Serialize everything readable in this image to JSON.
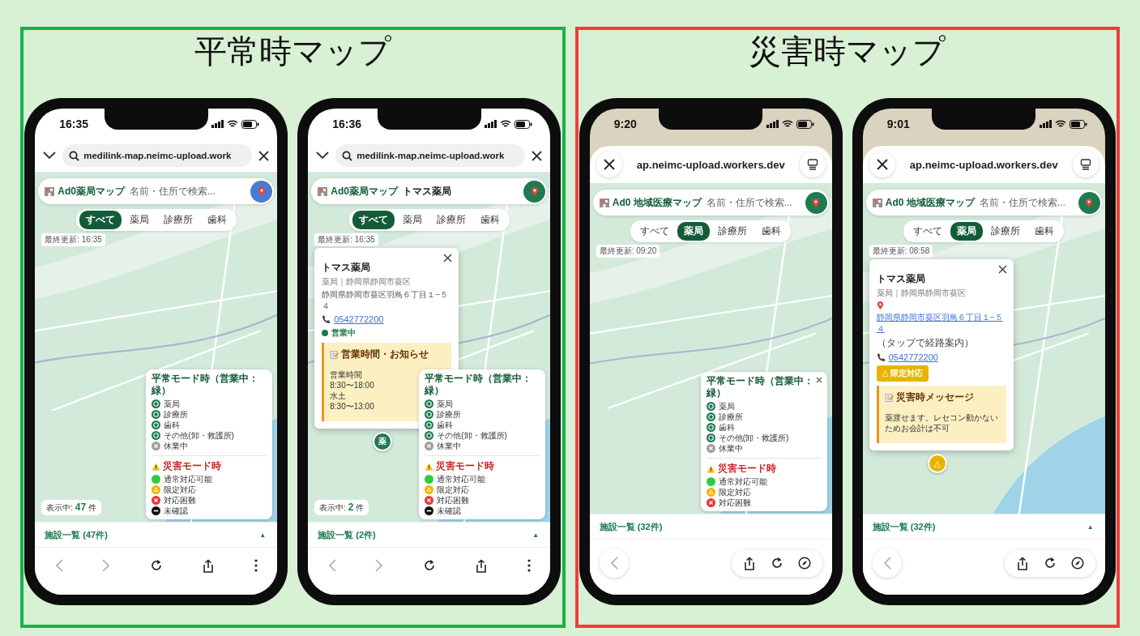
{
  "panels": [
    {
      "title": "平常時マップ",
      "color": "#17b24a",
      "phones": [
        {
          "time": "16:35",
          "browser": {
            "kind": "chrome",
            "url": "medilink-map.neimc-upload.work"
          },
          "app": {
            "title": "Ad0薬局マップ",
            "search_placeholder": "名前・住所で検索...",
            "locate_button": {
              "color": "#4a7bd0"
            }
          },
          "filters": [
            {
              "label": "すべて",
              "selected": true
            },
            {
              "label": "薬局",
              "selected": false
            },
            {
              "label": "診療所",
              "selected": false
            },
            {
              "label": "歯科",
              "selected": false
            }
          ],
          "last_updated": "最終更新: 16:35",
          "visible_count": {
            "label": "表示中:",
            "count": "47",
            "unit": "件"
          },
          "legend": {
            "closable": false,
            "sections": [
              {
                "kind": "normal",
                "title": "平常モード時（営業中：緑）",
                "items": [
                  {
                    "kind": "facility",
                    "label": "薬局",
                    "color": "#1e7b4f"
                  },
                  {
                    "kind": "facility",
                    "label": "診療所",
                    "color": "#1e7b4f"
                  },
                  {
                    "kind": "facility",
                    "label": "歯科",
                    "color": "#1e7b4f"
                  },
                  {
                    "kind": "facility",
                    "label": "その他(卸・救護所)",
                    "color": "#1e7b4f"
                  },
                  {
                    "kind": "closed",
                    "label": "休業中",
                    "color": "#9e9e9e"
                  }
                ]
              },
              {
                "kind": "disaster",
                "title": "災害モード時",
                "items": [
                  {
                    "kind": "available",
                    "label": "通常対応可能",
                    "color": "#2ecc40"
                  },
                  {
                    "kind": "limited",
                    "label": "限定対応",
                    "color": "#f0b400"
                  },
                  {
                    "kind": "difficult",
                    "label": "対応困難",
                    "color": "#e53935"
                  },
                  {
                    "kind": "unconfirmed",
                    "label": "未確認",
                    "color": "#111111"
                  }
                ]
              }
            ]
          },
          "list_bar": {
            "label": "施設一覧 (47件)",
            "toggle": "▲"
          }
        },
        {
          "time": "16:36",
          "browser": {
            "kind": "chrome",
            "url": "medilink-map.neimc-upload.work"
          },
          "app": {
            "title": "Ad0薬局マップ",
            "search_value": "トマス薬局",
            "locate_button": {
              "color": "#1e7b4f"
            }
          },
          "filters": [
            {
              "label": "すべて",
              "selected": true
            },
            {
              "label": "薬局",
              "selected": false
            },
            {
              "label": "診療所",
              "selected": false
            },
            {
              "label": "歯科",
              "selected": false
            }
          ],
          "last_updated": "最終更新: 16:35",
          "visible_count": {
            "label": "表示中:",
            "count": "2",
            "unit": "件"
          },
          "popup": {
            "name": "トマス薬局",
            "category": "薬局｜静岡県静岡市葵区",
            "address": {
              "kind": "plain",
              "text": "静岡県静岡市葵区羽鳥６丁目１−５４"
            },
            "phone": "0542772200",
            "status": {
              "kind": "open",
              "label": "営業中"
            },
            "notice": {
              "title": "営業時間・お知らせ",
              "lines": [
                "営業時間",
                "8:30〜18:00",
                "水土",
                "8:30〜13:00"
              ]
            },
            "marker": {
              "glyph": "薬",
              "color": "#1e7b4f"
            }
          },
          "legend": {
            "closable": false,
            "sections": [
              {
                "kind": "normal",
                "title": "平常モード時（営業中：緑）",
                "items": [
                  {
                    "kind": "facility",
                    "label": "薬局",
                    "color": "#1e7b4f"
                  },
                  {
                    "kind": "facility",
                    "label": "診療所",
                    "color": "#1e7b4f"
                  },
                  {
                    "kind": "facility",
                    "label": "歯科",
                    "color": "#1e7b4f"
                  },
                  {
                    "kind": "facility",
                    "label": "その他(卸・救護所)",
                    "color": "#1e7b4f"
                  },
                  {
                    "kind": "closed",
                    "label": "休業中",
                    "color": "#9e9e9e"
                  }
                ]
              },
              {
                "kind": "disaster",
                "title": "災害モード時",
                "items": [
                  {
                    "kind": "available",
                    "label": "通常対応可能",
                    "color": "#2ecc40"
                  },
                  {
                    "kind": "limited",
                    "label": "限定対応",
                    "color": "#f0b400"
                  },
                  {
                    "kind": "difficult",
                    "label": "対応困難",
                    "color": "#e53935"
                  },
                  {
                    "kind": "unconfirmed",
                    "label": "未確認",
                    "color": "#111111"
                  }
                ]
              }
            ]
          },
          "list_bar": {
            "label": "施設一覧 (2件)",
            "toggle": "▲"
          }
        }
      ]
    },
    {
      "title": "災害時マップ",
      "color": "#f03c3c",
      "phones": [
        {
          "time": "9:20",
          "browser": {
            "kind": "safari",
            "url": "ap.neimc-upload.workers.dev"
          },
          "app": {
            "title": "Ad0 地域医療マップ",
            "search_placeholder": "名前・住所で検索...",
            "locate_button": {
              "color": "#1e7b4f"
            }
          },
          "filters": [
            {
              "label": "すべて",
              "selected": false
            },
            {
              "label": "薬局",
              "selected": true
            },
            {
              "label": "診療所",
              "selected": false
            },
            {
              "label": "歯科",
              "selected": false
            }
          ],
          "last_updated": "最終更新: 09:20",
          "legend": {
            "closable": true,
            "sections": [
              {
                "kind": "normal",
                "title": "平常モード時（営業中：緑）",
                "items": [
                  {
                    "kind": "facility",
                    "label": "薬局",
                    "color": "#1e7b4f"
                  },
                  {
                    "kind": "facility",
                    "label": "診療所",
                    "color": "#1e7b4f"
                  },
                  {
                    "kind": "facility",
                    "label": "歯科",
                    "color": "#1e7b4f"
                  },
                  {
                    "kind": "facility",
                    "label": "その他(卸・救護所)",
                    "color": "#1e7b4f"
                  },
                  {
                    "kind": "closed",
                    "label": "休業中",
                    "color": "#9e9e9e"
                  }
                ]
              },
              {
                "kind": "disaster",
                "title": "災害モード時",
                "items": [
                  {
                    "kind": "available",
                    "label": "通常対応可能",
                    "color": "#2ecc40"
                  },
                  {
                    "kind": "limited",
                    "label": "限定対応",
                    "color": "#f0b400"
                  },
                  {
                    "kind": "difficult",
                    "label": "対応困難",
                    "color": "#e53935"
                  }
                ]
              }
            ]
          },
          "list_bar": {
            "label": "施設一覧 (32件)"
          }
        },
        {
          "time": "9:01",
          "browser": {
            "kind": "safari",
            "url": "ap.neimc-upload.workers.dev"
          },
          "app": {
            "title": "Ad0 地域医療マップ",
            "search_placeholder": "名前・住所で検索...",
            "locate_button": {
              "color": "#1e7b4f"
            }
          },
          "filters": [
            {
              "label": "すべて",
              "selected": false
            },
            {
              "label": "薬局",
              "selected": true
            },
            {
              "label": "診療所",
              "selected": false
            },
            {
              "label": "歯科",
              "selected": false
            }
          ],
          "last_updated": "最終更新: 08:58",
          "popup": {
            "name": "トマス薬局",
            "category": "薬局｜静岡県静岡市葵区",
            "address": {
              "kind": "link",
              "text": "静岡県静岡市葵区羽鳥６丁目１−５４",
              "hint": "（タップで経路案内）"
            },
            "phone": "0542772200",
            "status": {
              "kind": "limited",
              "label": "△ 限定対応"
            },
            "notice": {
              "title": "災害時メッセージ",
              "lines": [
                "薬渡せます。レセコン動かないためお会計は不可"
              ]
            },
            "marker": {
              "glyph": "△",
              "color": "#e8b400"
            }
          },
          "list_bar": {
            "label": "施設一覧 (32件)",
            "toggle": "▲"
          }
        }
      ]
    }
  ]
}
